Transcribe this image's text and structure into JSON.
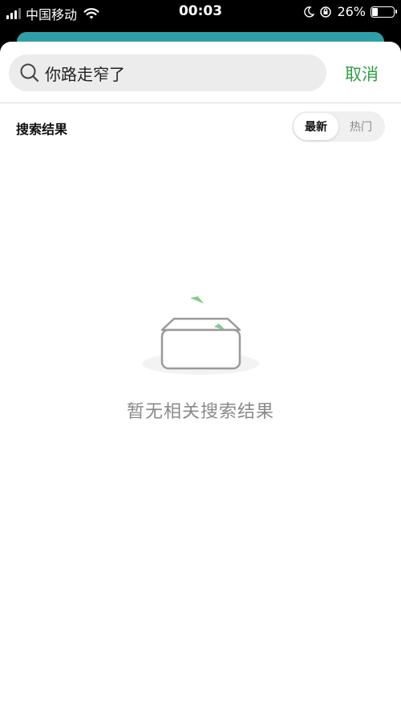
{
  "status_bar": {
    "carrier": "中国移动",
    "time": "00:03",
    "battery_percent": "26%",
    "battery_level": 0.26,
    "icons": [
      "signal-icon",
      "wifi-icon",
      "moon-icon",
      "orientation-lock-icon",
      "battery-icon"
    ]
  },
  "search": {
    "query": "你路走窄了",
    "cancel_label": "取消"
  },
  "results": {
    "title": "搜索结果",
    "sort_options": [
      "最新",
      "热门"
    ],
    "selected_sort": "最新"
  },
  "empty_state": {
    "message": "暂无相关搜索结果",
    "icon": "empty-box-icon"
  },
  "colors": {
    "accent_green": "#2fa048",
    "teal": "#2f9ea7",
    "search_bg": "#ececec",
    "empty_text": "#8a8a8a"
  }
}
